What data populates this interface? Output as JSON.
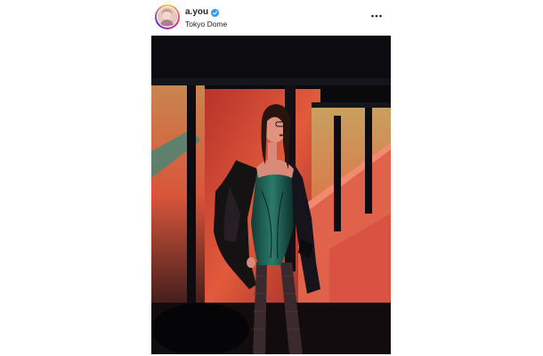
{
  "post": {
    "username": "a.you",
    "location": "Tokyo Dome",
    "avatar_icon": "profile-avatar",
    "verified_icon": "verified-badge-icon",
    "more_icon": "more-options-icon",
    "photo_alt": ""
  },
  "colors": {
    "verified_blue": "#3897f0",
    "text": "#262626",
    "photo_red": "#d8452f",
    "photo_dark": "#0a0a0d"
  }
}
